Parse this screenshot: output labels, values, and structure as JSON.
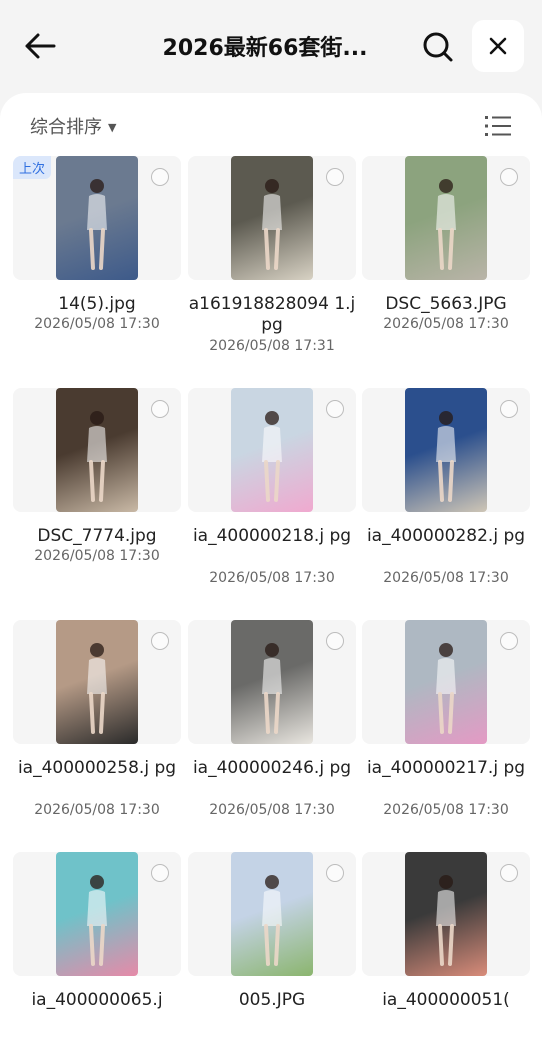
{
  "header": {
    "title": "2026最新66套街...",
    "back_icon": "back-arrow-icon",
    "search_icon": "search-icon",
    "close_icon": "close-icon"
  },
  "toolbar": {
    "sort_label": "综合排序",
    "sort_icon": "caret-down-icon",
    "view_icon": "list-view-icon"
  },
  "files": [
    {
      "name": "14(5).jpg",
      "date": "2026/05/08 17:30",
      "badge": "上次",
      "thumb_colors": [
        "#6b7a90",
        "#3d5a8a"
      ]
    },
    {
      "name": "a161918828094 1.jpg",
      "date": "2026/05/08 17:31",
      "badge": "",
      "thumb_colors": [
        "#5c5a50",
        "#d8d2c4"
      ]
    },
    {
      "name": "DSC_5663.JPG",
      "date": "2026/05/08 17:30",
      "badge": "",
      "thumb_colors": [
        "#8ca37e",
        "#b9b4a8"
      ]
    },
    {
      "name": "DSC_7774.jpg",
      "date": "2026/05/08 17:30",
      "badge": "",
      "thumb_colors": [
        "#4a3b30",
        "#c9b9a6"
      ]
    },
    {
      "name": "ia_400000218.j pg",
      "date": "2026/05/08 17:30",
      "badge": "",
      "thumb_colors": [
        "#c9d6e2",
        "#f0a9cf"
      ]
    },
    {
      "name": "ia_400000282.j pg",
      "date": "2026/05/08 17:30",
      "badge": "",
      "thumb_colors": [
        "#2b4f8d",
        "#cfc6b6"
      ]
    },
    {
      "name": "ia_400000258.j pg",
      "date": "2026/05/08 17:30",
      "badge": "",
      "thumb_colors": [
        "#b59a86",
        "#2a2a2a"
      ]
    },
    {
      "name": "ia_400000246.j pg",
      "date": "2026/05/08 17:30",
      "badge": "",
      "thumb_colors": [
        "#6a6a68",
        "#e9e6e0"
      ]
    },
    {
      "name": "ia_400000217.j pg",
      "date": "2026/05/08 17:30",
      "badge": "",
      "thumb_colors": [
        "#aeb8c2",
        "#e49ac4"
      ]
    },
    {
      "name": "ia_400000065.j",
      "date": "",
      "badge": "",
      "thumb_colors": [
        "#6fc2c9",
        "#e68aa8"
      ]
    },
    {
      "name": "005.JPG",
      "date": "",
      "badge": "",
      "thumb_colors": [
        "#c4d3e6",
        "#8bb56e"
      ]
    },
    {
      "name": "ia_400000051(",
      "date": "",
      "badge": "",
      "thumb_colors": [
        "#3a3a3a",
        "#d98c7a"
      ]
    }
  ]
}
